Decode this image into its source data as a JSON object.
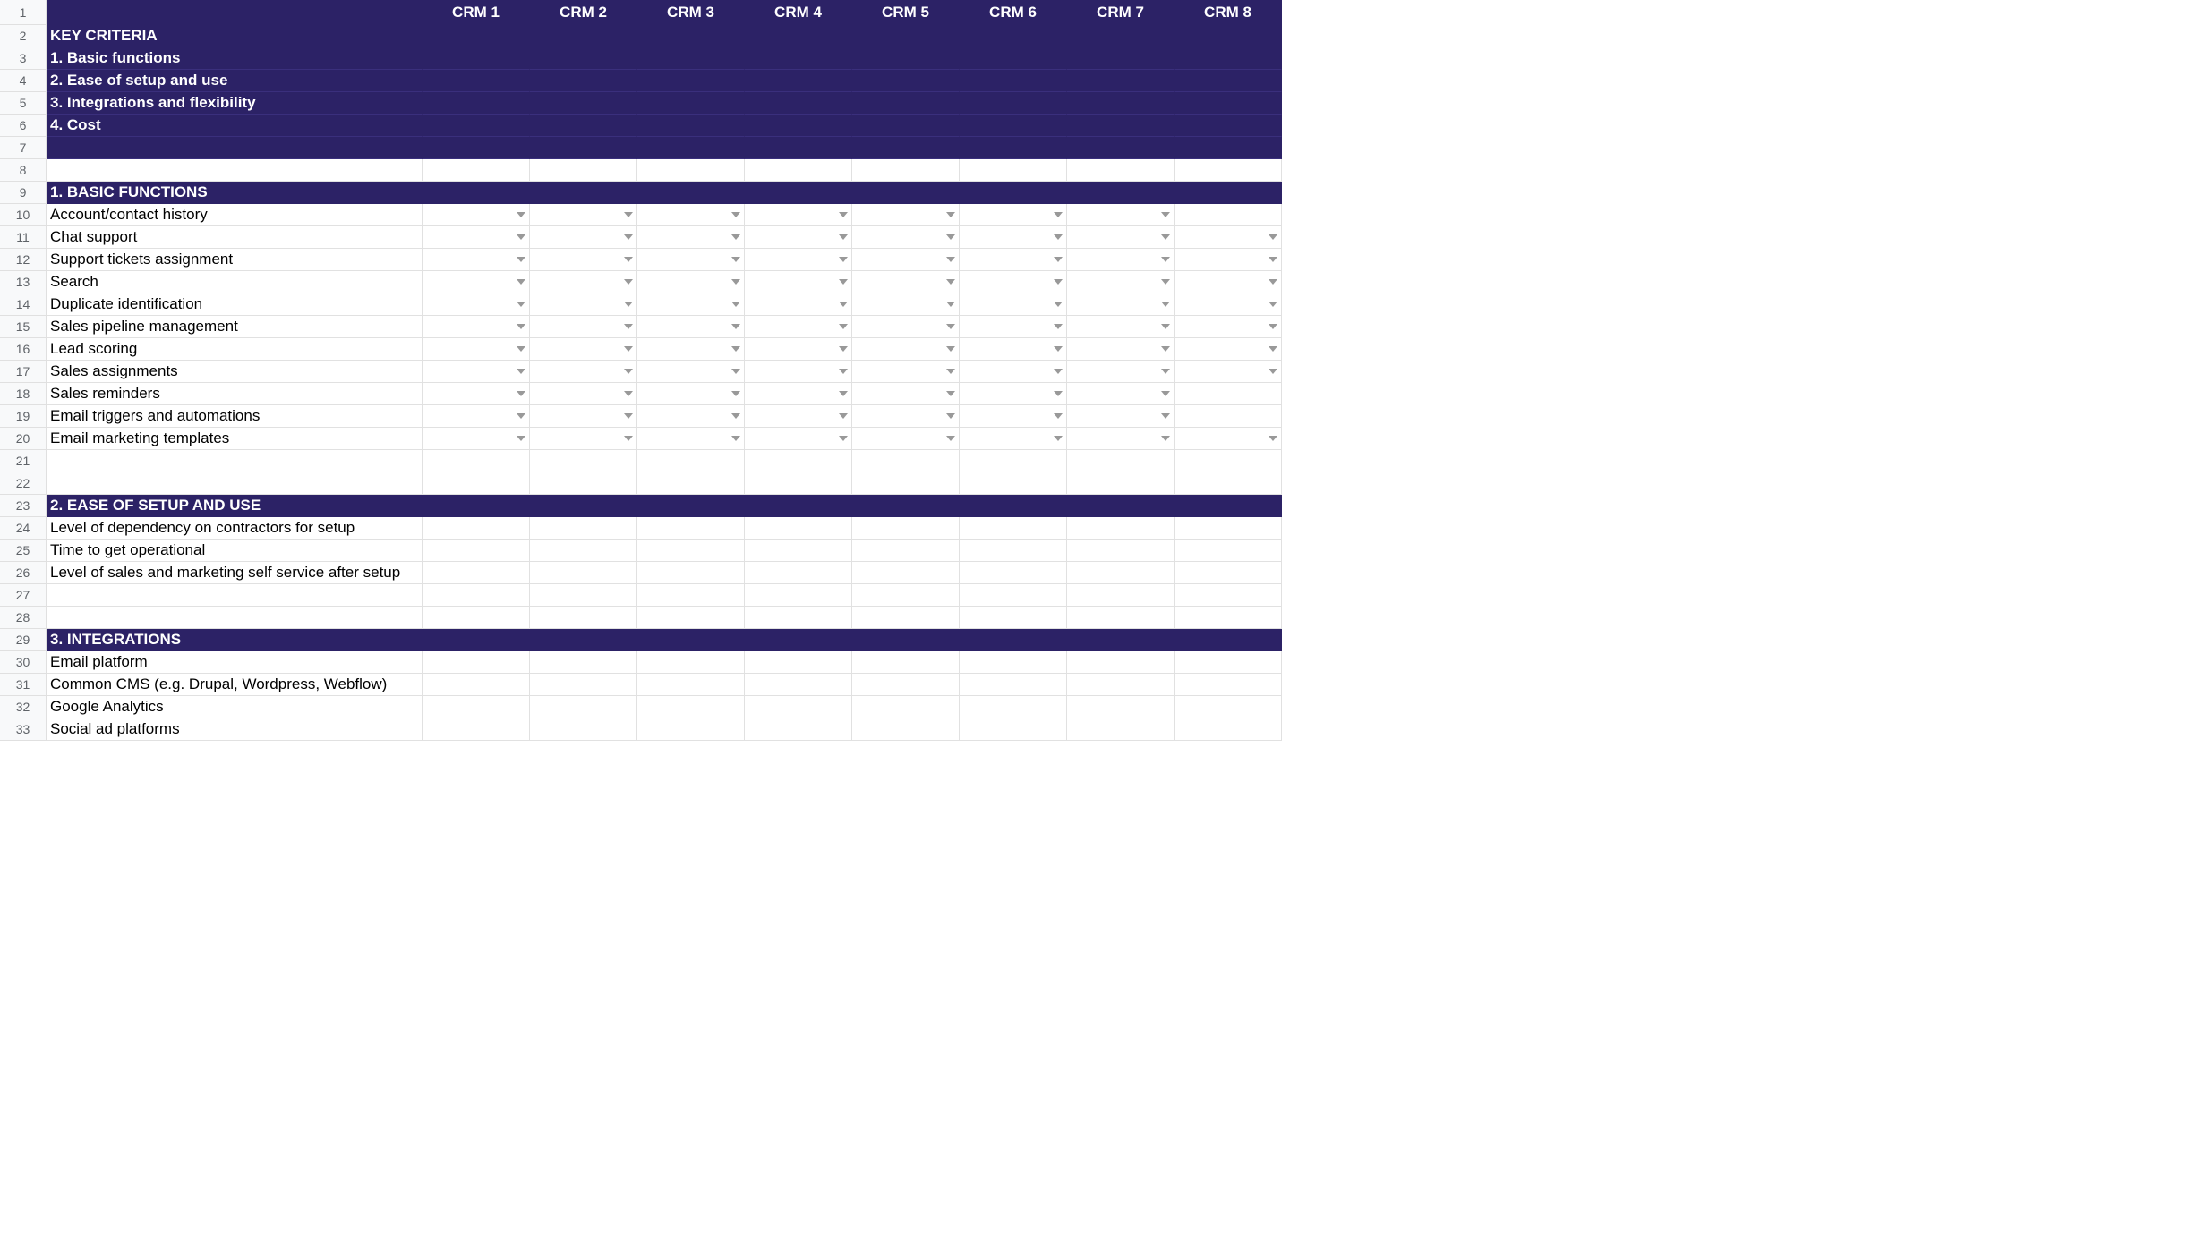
{
  "columns": [
    "CRM 1",
    "CRM 2",
    "CRM 3",
    "CRM 4",
    "CRM 5",
    "CRM 6",
    "CRM 7",
    "CRM 8"
  ],
  "rows": [
    {
      "n": 2,
      "type": "purple",
      "label": "KEY CRITERIA"
    },
    {
      "n": 3,
      "type": "purple",
      "label": "1. Basic functions"
    },
    {
      "n": 4,
      "type": "purple",
      "label": "2. Ease of setup and use"
    },
    {
      "n": 5,
      "type": "purple",
      "label": "3. Integrations and flexibility"
    },
    {
      "n": 6,
      "type": "purple",
      "label": "4. Cost"
    },
    {
      "n": 7,
      "type": "purple",
      "label": ""
    },
    {
      "n": 8,
      "type": "blank",
      "label": ""
    },
    {
      "n": 9,
      "type": "section",
      "label": "1. BASIC FUNCTIONS"
    },
    {
      "n": 10,
      "type": "data",
      "label": "Account/contact history",
      "dd": true,
      "ddcols": [
        1,
        1,
        1,
        1,
        1,
        1,
        1,
        0
      ]
    },
    {
      "n": 11,
      "type": "data",
      "label": "Chat support",
      "dd": true,
      "ddcols": [
        1,
        1,
        1,
        1,
        1,
        1,
        1,
        1
      ]
    },
    {
      "n": 12,
      "type": "data",
      "label": "Support tickets assignment",
      "dd": true,
      "ddcols": [
        1,
        1,
        1,
        1,
        1,
        1,
        1,
        1
      ]
    },
    {
      "n": 13,
      "type": "data",
      "label": "Search",
      "dd": true,
      "ddcols": [
        1,
        1,
        1,
        1,
        1,
        1,
        1,
        1
      ]
    },
    {
      "n": 14,
      "type": "data",
      "label": "Duplicate identification",
      "dd": true,
      "ddcols": [
        1,
        1,
        1,
        1,
        1,
        1,
        1,
        1
      ]
    },
    {
      "n": 15,
      "type": "data",
      "label": "Sales pipeline management",
      "dd": true,
      "ddcols": [
        1,
        1,
        1,
        1,
        1,
        1,
        1,
        1
      ]
    },
    {
      "n": 16,
      "type": "data",
      "label": "Lead scoring",
      "dd": true,
      "ddcols": [
        1,
        1,
        1,
        1,
        1,
        1,
        1,
        1
      ]
    },
    {
      "n": 17,
      "type": "data",
      "label": "Sales assignments",
      "dd": true,
      "ddcols": [
        1,
        1,
        1,
        1,
        1,
        1,
        1,
        1
      ]
    },
    {
      "n": 18,
      "type": "data",
      "label": "Sales reminders",
      "dd": true,
      "ddcols": [
        1,
        1,
        1,
        1,
        1,
        1,
        1,
        0
      ]
    },
    {
      "n": 19,
      "type": "data",
      "label": "Email triggers and automations",
      "dd": true,
      "ddcols": [
        1,
        1,
        1,
        1,
        1,
        1,
        1,
        0
      ]
    },
    {
      "n": 20,
      "type": "data",
      "label": "Email marketing templates",
      "dd": true,
      "ddcols": [
        1,
        1,
        1,
        1,
        1,
        1,
        1,
        1
      ]
    },
    {
      "n": 21,
      "type": "blank",
      "label": ""
    },
    {
      "n": 22,
      "type": "blank",
      "label": ""
    },
    {
      "n": 23,
      "type": "section",
      "label": "2. EASE OF SETUP AND USE"
    },
    {
      "n": 24,
      "type": "data",
      "label": "Level of dependency on contractors for setup",
      "dd": false
    },
    {
      "n": 25,
      "type": "data",
      "label": "Time to get operational",
      "dd": false
    },
    {
      "n": 26,
      "type": "data",
      "label": "Level of sales and marketing self service after setup",
      "dd": false
    },
    {
      "n": 27,
      "type": "blank",
      "label": ""
    },
    {
      "n": 28,
      "type": "blank",
      "label": ""
    },
    {
      "n": 29,
      "type": "section",
      "label": "3. INTEGRATIONS"
    },
    {
      "n": 30,
      "type": "data",
      "label": "Email platform",
      "dd": false
    },
    {
      "n": 31,
      "type": "data",
      "label": "Common CMS (e.g. Drupal, Wordpress, Webflow)",
      "dd": false
    },
    {
      "n": 32,
      "type": "data",
      "label": "Google Analytics",
      "dd": false
    },
    {
      "n": 33,
      "type": "data",
      "label": "Social ad platforms",
      "dd": false
    }
  ]
}
